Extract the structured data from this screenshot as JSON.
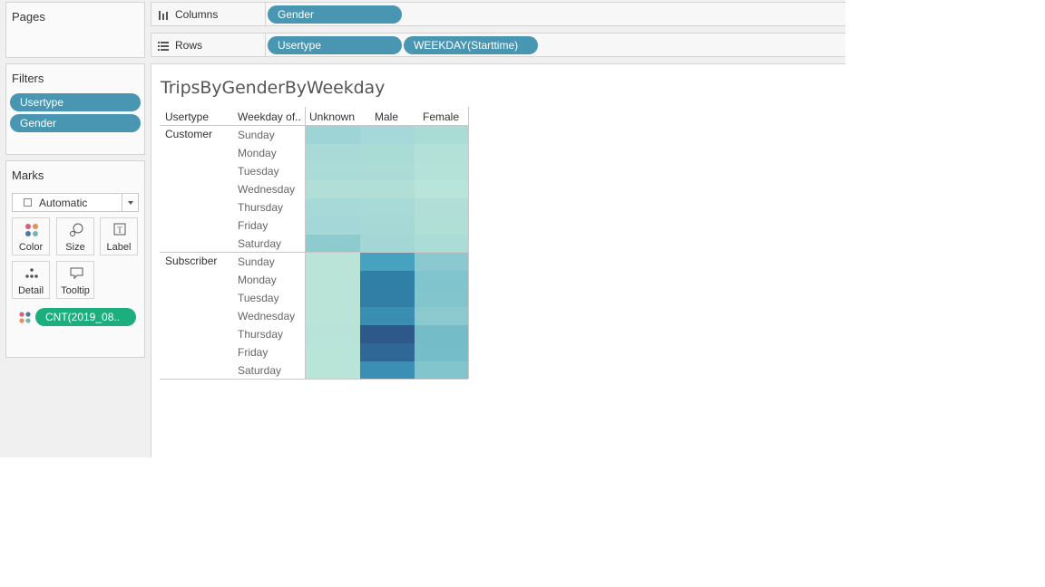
{
  "panels": {
    "pages": {
      "title": "Pages"
    },
    "filters": {
      "title": "Filters",
      "items": [
        "Usertype",
        "Gender"
      ]
    },
    "marks": {
      "title": "Marks",
      "mark_type": "Automatic",
      "buttons": [
        "Color",
        "Size",
        "Label",
        "Detail",
        "Tooltip"
      ],
      "color_field": "CNT(2019_08.."
    }
  },
  "shelves": {
    "columns": {
      "label": "Columns",
      "pills": [
        "Gender"
      ]
    },
    "rows": {
      "label": "Rows",
      "pills": [
        "Usertype",
        "WEEKDAY(Starttime)"
      ]
    }
  },
  "viz": {
    "title": "TripsByGenderByWeekday",
    "headers": {
      "usertype": "Usertype",
      "weekday": "Weekday of..",
      "genders": [
        "Unknown",
        "Male",
        "Female"
      ]
    },
    "groups": [
      {
        "name": "Customer",
        "days": [
          "Sunday",
          "Monday",
          "Tuesday",
          "Wednesday",
          "Thursday",
          "Friday",
          "Saturday"
        ]
      },
      {
        "name": "Subscriber",
        "days": [
          "Sunday",
          "Monday",
          "Tuesday",
          "Wednesday",
          "Thursday",
          "Friday",
          "Saturday"
        ]
      }
    ],
    "cell_colors": [
      [
        "#9ed4d6",
        "#a5d8d8",
        "#aadcd6"
      ],
      [
        "#a9dad8",
        "#aadcd6",
        "#b4e1d7"
      ],
      [
        "#acdcd8",
        "#addcd6",
        "#b4e2d8"
      ],
      [
        "#b1dfd8",
        "#b1dfd6",
        "#b8e4d9"
      ],
      [
        "#a6d9d7",
        "#a8dad7",
        "#b1dfd7"
      ],
      [
        "#a4d8d8",
        "#a6d8d6",
        "#b0dfd6"
      ],
      [
        "#8ecbcf",
        "#a3d7d6",
        "#acdcd6"
      ],
      [
        "#bae4d8",
        "#46a3c0",
        "#8ac9cf"
      ],
      [
        "#bae4d8",
        "#307fa6",
        "#80c4cd"
      ],
      [
        "#bae4d8",
        "#317fa6",
        "#82c5cc"
      ],
      [
        "#bae4d8",
        "#3a8eb2",
        "#8bc9ce"
      ],
      [
        "#b8e3d8",
        "#2d5887",
        "#73bcc8"
      ],
      [
        "#b9e4d8",
        "#2f6897",
        "#75bdc9"
      ],
      [
        "#b9e4d8",
        "#3b8fb4",
        "#82c5cc"
      ]
    ]
  }
}
